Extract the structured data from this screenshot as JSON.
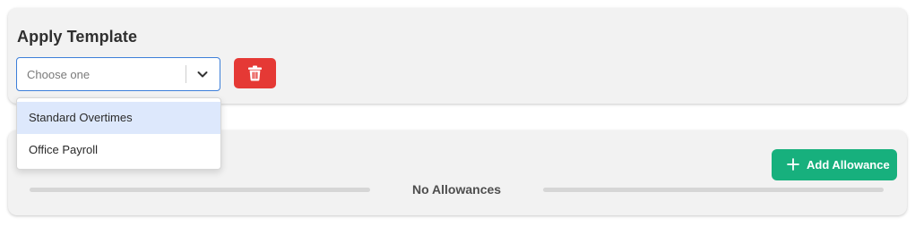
{
  "template_section": {
    "title": "Apply Template",
    "select": {
      "placeholder": "Choose one",
      "options": [
        "Standard Overtimes",
        "Office Payroll"
      ],
      "highlighted_option": "Standard Overtimes"
    },
    "delete_icon": "trash-icon"
  },
  "allowances_section": {
    "add_button_label": "Add Allowance",
    "add_icon": "plus-icon",
    "empty_message": "No Allowances"
  },
  "colors": {
    "select_focus_border": "#3d7fd9",
    "delete_button": "#e53935",
    "add_button": "#17b07d",
    "option_highlight": "#dde8fc",
    "card_background": "#f2f2f2"
  }
}
